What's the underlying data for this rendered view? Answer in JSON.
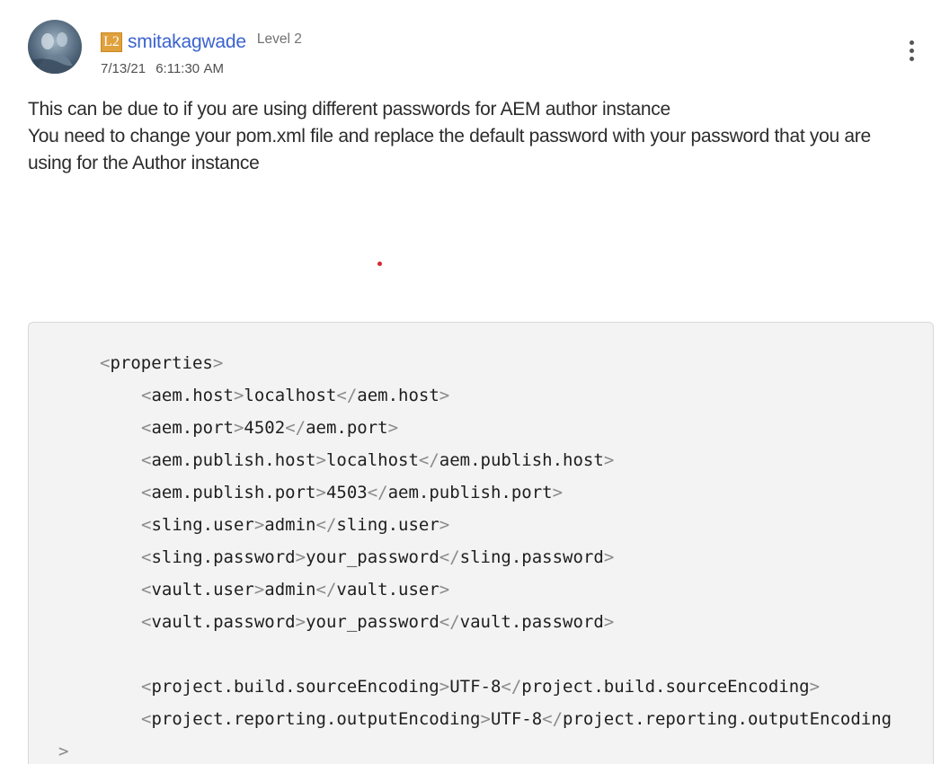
{
  "post": {
    "avatar_icon": "user-avatar-photo",
    "rank_badge": "L2",
    "username": "smitakagwade",
    "level": "Level 2",
    "date": "7/13/21",
    "time": "6:11:30 AM",
    "more_icon": "vertical-ellipsis-icon",
    "body_lines": [
      "This can be due to if you are using different passwords for AEM author instance",
      "You need to change your pom.xml file and replace the default password with your password that you are using for the Author instance"
    ]
  },
  "code": {
    "open_tag": "properties",
    "entries": [
      {
        "tag": "aem.host",
        "value": "localhost"
      },
      {
        "tag": "aem.port",
        "value": "4502"
      },
      {
        "tag": "aem.publish.host",
        "value": "localhost"
      },
      {
        "tag": "aem.publish.port",
        "value": "4503"
      },
      {
        "tag": "sling.user",
        "value": "admin"
      },
      {
        "tag": "sling.password",
        "value": "your_password"
      },
      {
        "tag": "vault.user",
        "value": "admin"
      },
      {
        "tag": "vault.password",
        "value": "your_password"
      },
      {
        "tag": "project.build.sourceEncoding",
        "value": "UTF-8"
      },
      {
        "tag": "project.reporting.outputEncoding",
        "value": "UTF-8"
      }
    ],
    "trailing_fragment": ">"
  },
  "colors": {
    "username": "#3b63cf",
    "rank_badge": "#e0a03c",
    "code_background": "#f3f3f3",
    "code_bracket": "#8a8a8a",
    "accent_dot": "#d7282f"
  }
}
